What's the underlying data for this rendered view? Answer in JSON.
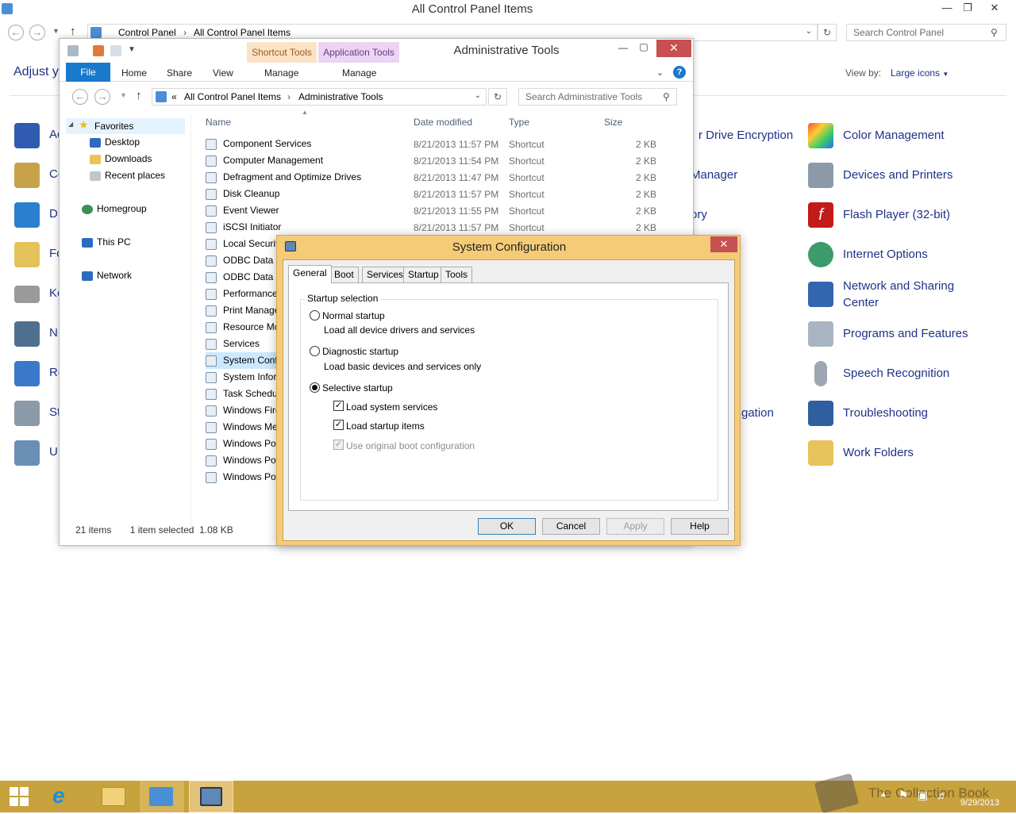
{
  "control_panel": {
    "title": "All Control Panel Items",
    "breadcrumb": [
      "Control Panel",
      "All Control Panel Items"
    ],
    "search_placeholder": "Search Control Panel",
    "adjust_heading": "Adjust y",
    "view_by_label": "View by:",
    "view_by_value": "Large icons",
    "left_partial": [
      "Ac",
      "Co",
      "D",
      "Fo",
      "Ke",
      "N",
      "Re",
      "St",
      "U"
    ],
    "mid_partial": [
      "r Drive Encryption",
      "Manager",
      "ory",
      "gation"
    ],
    "right_items": [
      "Color Management",
      "Devices and Printers",
      "Flash Player (32-bit)",
      "Internet Options",
      "Network and Sharing Center",
      "Programs and Features",
      "Speech Recognition",
      "Troubleshooting",
      "Work Folders"
    ]
  },
  "admin_tools": {
    "title": "Administrative Tools",
    "contextual_tabs": [
      "Shortcut Tools",
      "Application Tools"
    ],
    "ribbon_tabs": [
      "File",
      "Home",
      "Share",
      "View",
      "Manage",
      "Manage"
    ],
    "address_prefix": "«",
    "breadcrumb": [
      "All Control Panel Items",
      "Administrative Tools"
    ],
    "search_placeholder": "Search Administrative Tools",
    "nav": {
      "favorites": "Favorites",
      "favorite_items": [
        "Desktop",
        "Downloads",
        "Recent places"
      ],
      "homegroup": "Homegroup",
      "this_pc": "This PC",
      "network": "Network"
    },
    "columns": [
      "Name",
      "Date modified",
      "Type",
      "Size"
    ],
    "files": [
      {
        "name": "Component Services",
        "date": "8/21/2013 11:57 PM",
        "type": "Shortcut",
        "size": "2 KB"
      },
      {
        "name": "Computer Management",
        "date": "8/21/2013 11:54 PM",
        "type": "Shortcut",
        "size": "2 KB"
      },
      {
        "name": "Defragment and Optimize Drives",
        "date": "8/21/2013 11:47 PM",
        "type": "Shortcut",
        "size": "2 KB"
      },
      {
        "name": "Disk Cleanup",
        "date": "8/21/2013 11:57 PM",
        "type": "Shortcut",
        "size": "2 KB"
      },
      {
        "name": "Event Viewer",
        "date": "8/21/2013 11:55 PM",
        "type": "Shortcut",
        "size": "2 KB"
      },
      {
        "name": "iSCSI Initiator",
        "date": "8/21/2013 11:57 PM",
        "type": "Shortcut",
        "size": "2 KB"
      },
      {
        "name": "Local Securit"
      },
      {
        "name": "ODBC Data S"
      },
      {
        "name": "ODBC Data S"
      },
      {
        "name": "Performance"
      },
      {
        "name": "Print Manage"
      },
      {
        "name": "Resource Mo"
      },
      {
        "name": "Services"
      },
      {
        "name": "System Conf"
      },
      {
        "name": "System Inforı"
      },
      {
        "name": "Task Schedul"
      },
      {
        "name": "Windows Fire"
      },
      {
        "name": "Windows Me"
      },
      {
        "name": "Windows Pov"
      },
      {
        "name": "Windows Pov"
      },
      {
        "name": "Windows Pov"
      }
    ],
    "status_count": "21 items",
    "status_selected": "1 item selected  1.08 KB"
  },
  "sysconfig": {
    "title": "System Configuration",
    "tabs": [
      "General",
      "Boot",
      "Services",
      "Startup",
      "Tools"
    ],
    "group_label": "Startup selection",
    "normal_label": "Normal startup",
    "normal_desc": "Load all device drivers and services",
    "diagnostic_label": "Diagnostic startup",
    "diagnostic_desc": "Load basic devices and services only",
    "selective_label": "Selective startup",
    "load_system_services": "Load system services",
    "load_startup_items": "Load startup items",
    "use_original_boot": "Use original boot configuration",
    "buttons": {
      "ok": "OK",
      "cancel": "Cancel",
      "apply": "Apply",
      "help": "Help"
    }
  },
  "taskbar": {
    "watermark": "The Collection Book",
    "date": "9/29/2013"
  }
}
